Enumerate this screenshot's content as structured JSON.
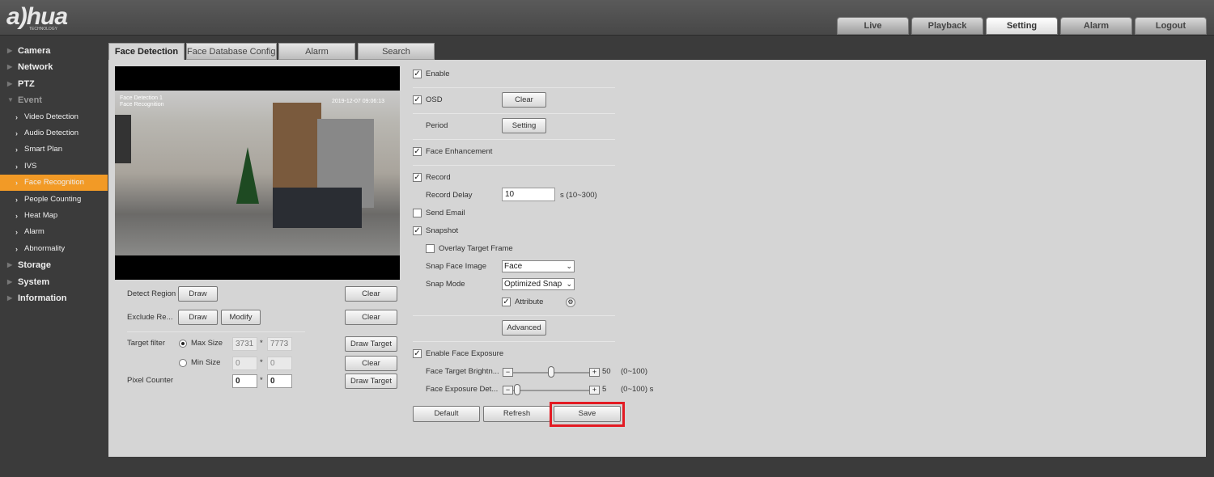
{
  "header": {
    "logo": "alhua",
    "logo_sub": "TECHNOLOGY",
    "nav": [
      {
        "label": "Live"
      },
      {
        "label": "Playback"
      },
      {
        "label": "Setting",
        "active": true
      },
      {
        "label": "Alarm"
      },
      {
        "label": "Logout"
      }
    ]
  },
  "sidebar": {
    "items": [
      {
        "label": "Camera"
      },
      {
        "label": "Network"
      },
      {
        "label": "PTZ"
      },
      {
        "label": "Event",
        "expanded": true
      },
      {
        "label": "Video Detection"
      },
      {
        "label": "Audio Detection"
      },
      {
        "label": "Smart Plan"
      },
      {
        "label": "IVS"
      },
      {
        "label": "Face Recognition",
        "active": true
      },
      {
        "label": "People Counting"
      },
      {
        "label": "Heat Map"
      },
      {
        "label": "Alarm"
      },
      {
        "label": "Abnormality"
      },
      {
        "label": "Storage"
      },
      {
        "label": "System"
      },
      {
        "label": "Information"
      }
    ]
  },
  "tabs": [
    {
      "label": "Face Detection",
      "active": true
    },
    {
      "label": "Face Database Config"
    },
    {
      "label": "Alarm"
    },
    {
      "label": "Search"
    }
  ],
  "video": {
    "osd_left": "Face Detection 1\nFace Recognition",
    "osd_time": "2019-12-07 09:06:13"
  },
  "left": {
    "detect_region": "Detect Region",
    "exclude_region": "Exclude Re...",
    "draw": "Draw",
    "modify": "Modify",
    "clear": "Clear",
    "target_filter": "Target filter",
    "max_size": "Max Size",
    "min_size": "Min Size",
    "selected_size": "Max Size",
    "max_w": "3731",
    "max_h": "7773",
    "min_w": "0",
    "min_h": "0",
    "times": "*",
    "pixel_counter": "Pixel Counter",
    "pc_w": "0",
    "pc_h": "0",
    "draw_target": "Draw Target"
  },
  "right": {
    "enable": {
      "label": "Enable",
      "checked": true
    },
    "osd": {
      "label": "OSD",
      "checked": true,
      "button": "Clear"
    },
    "period": {
      "label": "Period",
      "button": "Setting"
    },
    "face_enhancement": {
      "label": "Face Enhancement",
      "checked": true
    },
    "record": {
      "label": "Record",
      "checked": true
    },
    "record_delay": {
      "label": "Record Delay",
      "value": "10",
      "unit": "s (10~300)"
    },
    "send_email": {
      "label": "Send Email",
      "checked": false
    },
    "snapshot": {
      "label": "Snapshot",
      "checked": true
    },
    "overlay": {
      "label": "Overlay Target Frame",
      "checked": false
    },
    "snap_face_image": {
      "label": "Snap Face Image",
      "value": "Face"
    },
    "snap_mode": {
      "label": "Snap Mode",
      "value": "Optimized Snap"
    },
    "attribute": {
      "label": "Attribute",
      "checked": true
    },
    "advanced": "Advanced",
    "face_exposure": {
      "label": "Enable Face Exposure",
      "checked": true
    },
    "brightness": {
      "label": "Face Target Brightn...",
      "value": 50,
      "range": "(0~100)"
    },
    "exposure_delay": {
      "label": "Face Exposure Det...",
      "value": 5,
      "range": "(0~100) s"
    },
    "default": "Default",
    "refresh": "Refresh",
    "save": "Save",
    "highlight_color": "#e31b23"
  }
}
